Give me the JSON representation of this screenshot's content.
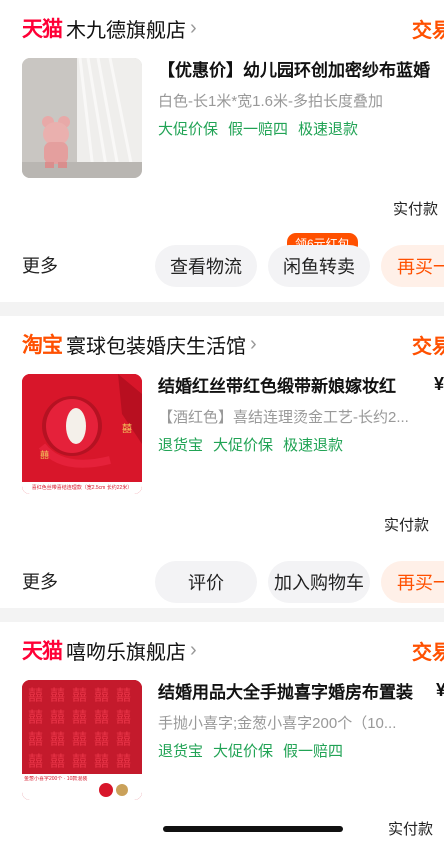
{
  "orders": [
    {
      "platform": "天猫",
      "platform_color": "#ff0036",
      "shop": "木九德旗舰店",
      "status": "交易",
      "title": "【优惠价】幼儿园环创加密纱布蓝婚",
      "spec": "白色-长1米*宽1.6米-多拍长度叠加",
      "tags": [
        "大促价保",
        "假一赔四",
        "极速退款"
      ],
      "price_symbol": "",
      "paid_label": "实付款",
      "more_label": "更多",
      "buttons": [
        "查看物流",
        "闲鱼转卖",
        "再买一"
      ],
      "badge": "领6元红包",
      "thumb_icon": "bear-figurine-with-veil"
    },
    {
      "platform": "淘宝",
      "platform_color": "#ff5000",
      "shop": "寰球包装婚庆生活馆",
      "status": "交易",
      "title": "结婚红丝带红色缎带新娘嫁妆红",
      "spec": "【酒红色】喜结连理烫金工艺-长约2...",
      "tags": [
        "退货宝",
        "大促价保",
        "极速退款"
      ],
      "price_symbol": "¥",
      "paid_label": "实付款",
      "more_label": "更多",
      "buttons": [
        "评价",
        "加入购物车",
        "再买一"
      ],
      "badge": "",
      "thumb_caption": "喜红色丝带喜结连理款（宽2.5cm 长约22米）",
      "thumb_icon": "red-ribbon-roll"
    },
    {
      "platform": "天猫",
      "platform_color": "#ff0036",
      "shop": "嘻吻乐旗舰店",
      "status": "交易",
      "title": "结婚用品大全手抛喜字婚房布置装",
      "spec": "手抛小喜字;金葱小喜字200个（10...",
      "tags": [
        "退货宝",
        "大促价保",
        "假一赔四"
      ],
      "price_symbol": "¥",
      "paid_label": "实付款",
      "thumb_caption": "金葱小喜字200个 · 10款混装",
      "thumb_icon": "red-xi-characters"
    }
  ],
  "colors": {
    "accent": "#ff5000",
    "tag_green": "#21a355",
    "muted": "#999999"
  }
}
